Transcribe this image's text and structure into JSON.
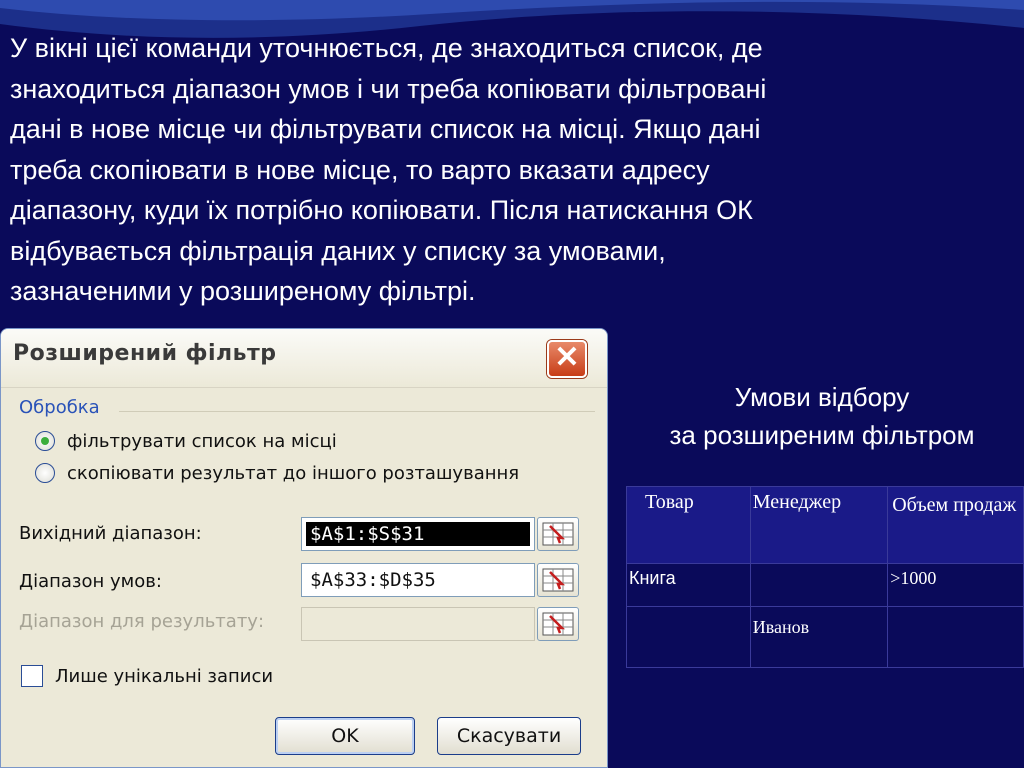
{
  "paragraph": "У вікні цієї команди уточнюється, де знаходиться список, де\nзнаходиться діапазон умов і чи треба копіювати фільтровані\nдані в нове місце чи фільтрувати список на місці. Якщо дані\nтреба скопіювати в нове місце, то варто вказати адресу\nдіапазону, куди їх потрібно копіювати. Після натискання ОК\nвідбувається фільтрація даних у списку за умовами,\nзазначеними у розширеному фільтрі.",
  "caption": "Умови відбору\nза розширеним фільтром",
  "dialog": {
    "title": "Розширений фільтр",
    "close_glyph": "✕",
    "group_label": "Обробка",
    "radio_filter_in_place": "фільтрувати список на місці",
    "radio_copy_elsewhere": "скопіювати результат до іншого розташування",
    "selected_option": "фільтрувати список на місці",
    "source_range_label": "Вихідний діапазон:",
    "source_range_value": "$A$1:$S$31",
    "criteria_range_label": "Діапазон умов:",
    "criteria_range_value": "$A$33:$D$35",
    "result_range_label": "Діапазон для результату:",
    "result_range_value": "",
    "unique_only_label": "Лише унікальні записи",
    "unique_only_checked": false,
    "ok_label": "OK",
    "cancel_label": "Скасувати"
  },
  "criteria_table": {
    "headers": [
      "Товар",
      "Менеджер",
      "Объем продаж"
    ],
    "rows": [
      [
        "Книга",
        "",
        ">1000"
      ],
      [
        "",
        "Иванов",
        ""
      ]
    ]
  },
  "colors": {
    "background": "#0a0a5a",
    "text": "#ffffff",
    "dialog_face": "#ece9d8",
    "close_button": "#c83d17",
    "group_label": "#2a53b8"
  }
}
